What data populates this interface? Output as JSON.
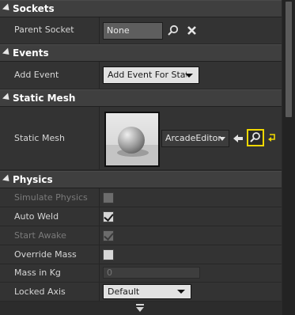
{
  "sections": {
    "sockets": {
      "title": "Sockets",
      "parent_socket_label": "Parent Socket",
      "parent_socket_value": "None"
    },
    "events": {
      "title": "Events",
      "add_event_label": "Add Event",
      "add_event_button": "Add Event For StaticMeshComponent"
    },
    "static_mesh": {
      "title": "Static Mesh",
      "static_mesh_label": "Static Mesh",
      "asset_name": "ArcadeEditorSphere"
    },
    "physics": {
      "title": "Physics",
      "simulate_physics_label": "Simulate Physics",
      "auto_weld_label": "Auto Weld",
      "start_awake_label": "Start Awake",
      "override_mass_label": "Override Mass",
      "mass_label": "Mass in Kg",
      "mass_value": "0",
      "locked_axis_label": "Locked Axis",
      "locked_axis_value": "Default"
    }
  },
  "states": {
    "simulate_physics": false,
    "auto_weld": true,
    "start_awake": true,
    "override_mass": false
  },
  "icons": {
    "browse": "magnifier-icon",
    "clear": "close-x-icon",
    "use_selected": "arrow-left-icon",
    "reset": "reset-arrow-icon",
    "expand_more": "chevron-down-icon"
  },
  "colors": {
    "highlight": "#f0d800",
    "header_bg": "#3f3f3f",
    "row_bg": "#333333"
  }
}
